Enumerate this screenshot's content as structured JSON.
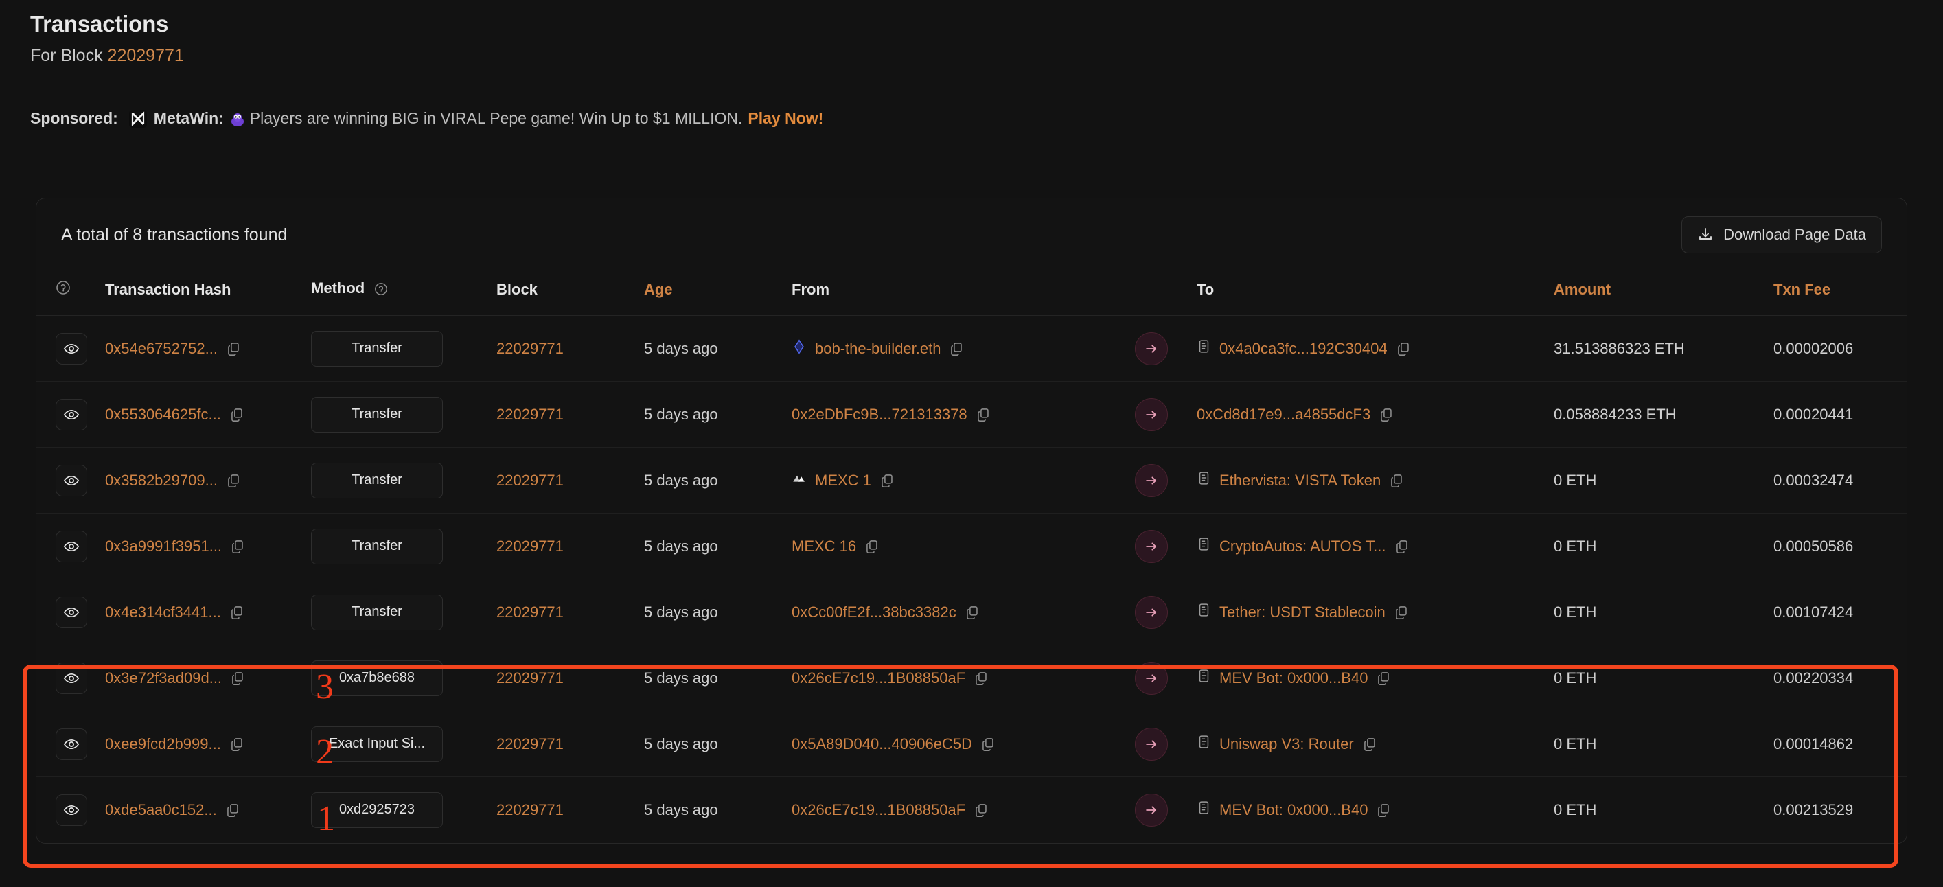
{
  "header": {
    "title": "Transactions",
    "subtitle_prefix": "For Block",
    "block_number": "22029771"
  },
  "sponsored": {
    "label": "Sponsored:",
    "brand_icon": "metawin-logo-icon",
    "brand": "MetaWin:",
    "emoji_icon": "pepe-emoji-icon",
    "text": "Players are winning BIG in VIRAL Pepe game! Win Up to $1 MILLION.",
    "cta": "Play Now!",
    "cta_color": "#e38b3d"
  },
  "card": {
    "total_text": "A total of 8 transactions found",
    "download_button": "Download Page Data",
    "download_icon": "download-icon"
  },
  "table": {
    "headers": {
      "eye": "",
      "hash": "Transaction Hash",
      "method": "Method",
      "block": "Block",
      "age": "Age",
      "from": "From",
      "arrow": "",
      "to": "To",
      "amount": "Amount",
      "fee": "Txn Fee"
    },
    "rows": [
      {
        "hash": "0x54e6752752...",
        "method": "Transfer",
        "block": "22029771",
        "age": "5 days ago",
        "from": "bob-the-builder.eth",
        "from_icon": "ens-icon",
        "to": "0x4a0ca3fc...192C30404",
        "to_icon": "contract-icon",
        "amount": "31.513886323 ETH",
        "fee": "0.00002006"
      },
      {
        "hash": "0x553064625fc...",
        "method": "Transfer",
        "block": "22029771",
        "age": "5 days ago",
        "from": "0x2eDbFc9B...721313378",
        "from_icon": "",
        "to": "0xCd8d17e9...a4855dcF3",
        "to_icon": "",
        "amount": "0.058884233 ETH",
        "fee": "0.00020441"
      },
      {
        "hash": "0x3582b29709...",
        "method": "Transfer",
        "block": "22029771",
        "age": "5 days ago",
        "from": "MEXC 1",
        "from_icon": "mexc-icon",
        "to": "Ethervista: VISTA Token",
        "to_icon": "contract-icon",
        "amount": "0 ETH",
        "fee": "0.00032474"
      },
      {
        "hash": "0x3a9991f3951...",
        "method": "Transfer",
        "block": "22029771",
        "age": "5 days ago",
        "from": "MEXC 16",
        "from_icon": "",
        "to": "CryptoAutos: AUTOS T...",
        "to_icon": "contract-icon",
        "amount": "0 ETH",
        "fee": "0.00050586"
      },
      {
        "hash": "0x4e314cf3441...",
        "method": "Transfer",
        "block": "22029771",
        "age": "5 days ago",
        "from": "0xCc00fE2f...38bc3382c",
        "from_icon": "",
        "to": "Tether: USDT Stablecoin",
        "to_icon": "contract-icon",
        "amount": "0 ETH",
        "fee": "0.00107424"
      },
      {
        "hash": "0x3e72f3ad09d...",
        "method": "0xa7b8e688",
        "block": "22029771",
        "age": "5 days ago",
        "from": "0x26cE7c19...1B08850aF",
        "from_icon": "",
        "to": "MEV Bot: 0x000...B40",
        "to_icon": "contract-icon",
        "amount": "0 ETH",
        "fee": "0.00220334"
      },
      {
        "hash": "0xee9fcd2b999...",
        "method": "Exact Input Si...",
        "block": "22029771",
        "age": "5 days ago",
        "from": "0x5A89D040...40906eC5D",
        "from_icon": "",
        "to": "Uniswap V3: Router",
        "to_icon": "contract-icon",
        "amount": "0 ETH",
        "fee": "0.00014862"
      },
      {
        "hash": "0xde5aa0c152...",
        "method": "0xd2925723",
        "block": "22029771",
        "age": "5 days ago",
        "from": "0x26cE7c19...1B08850aF",
        "from_icon": "",
        "to": "MEV Bot: 0x000...B40",
        "to_icon": "contract-icon",
        "amount": "0 ETH",
        "fee": "0.00213529"
      }
    ]
  },
  "annotations": {
    "highlight_color": "#f4451e",
    "markers": [
      {
        "label": "3"
      },
      {
        "label": "2"
      },
      {
        "label": "1"
      }
    ]
  },
  "colors": {
    "accent_orange": "#cf8345",
    "background": "#121212",
    "card_background": "#131313"
  }
}
